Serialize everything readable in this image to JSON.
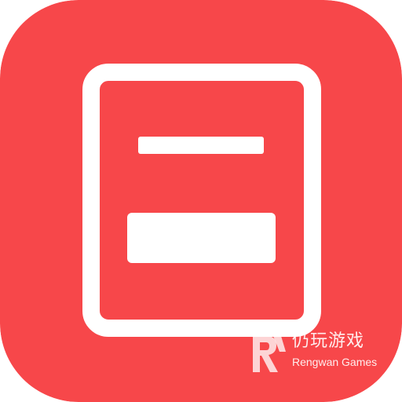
{
  "app_icon": {
    "name": "form-document-app-icon",
    "background_color": "#F7474A",
    "glyph_color": "#FFFFFF",
    "glyph_icon": "document-form-icon"
  },
  "watermark": {
    "logo_icon": "rengwan-logo-icon",
    "text_cn": "仍玩游戏",
    "text_en": "Rengwan Games"
  }
}
